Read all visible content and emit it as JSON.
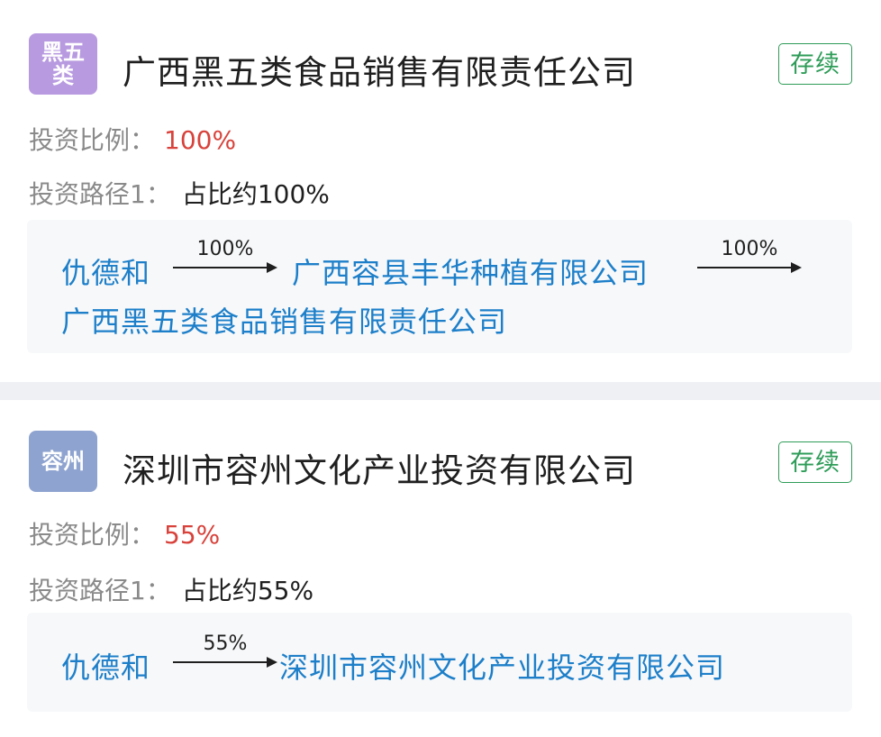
{
  "companies": [
    {
      "logo_lines": [
        "黑五",
        "类"
      ],
      "name": "广西黑五类食品销售有限责任公司",
      "status": "存续",
      "ratio_label": "投资比例：",
      "ratio_value": "100%",
      "path_label": "投资路径1：",
      "path_value": "占比约100%",
      "path": {
        "investor": "仇德和",
        "arrow1_pct": "100%",
        "intermediate": "广西容县丰华种植有限公司",
        "arrow2_pct": "100%",
        "target": "广西黑五类食品销售有限责任公司"
      }
    },
    {
      "logo_lines": [
        "容州"
      ],
      "name": "深圳市容州文化产业投资有限公司",
      "status": "存续",
      "ratio_label": "投资比例：",
      "ratio_value": "55%",
      "path_label": "投资路径1：",
      "path_value": "占比约55%",
      "path": {
        "investor": "仇德和",
        "arrow1_pct": "55%",
        "target": "深圳市容州文化产业投资有限公司"
      }
    }
  ],
  "colors": {
    "link_blue": "#1d7fc9",
    "percent_red": "#d8423b",
    "status_green": "#2e9c58",
    "logo1_purple": "#b89ae0",
    "logo2_blue": "#8ea3cf"
  }
}
